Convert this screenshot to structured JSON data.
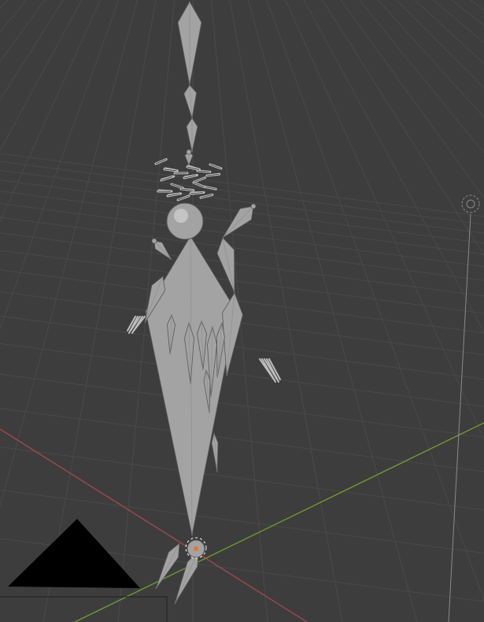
{
  "viewport": {
    "mode": "3d-viewport",
    "background_color": "#3d3d3d",
    "grid_color": "#4a4a4a",
    "x_axis_color": "#a0484e",
    "y_axis_color": "#6f9a2e",
    "bone_fill": "#a3a3a3",
    "bone_stroke": "#585858",
    "camera_color": "#000000",
    "origin_marker_color": "#e8742a",
    "light_gizmo_color": "#8a8a8a",
    "objects": [
      {
        "name": "armature",
        "type": "armature-bones"
      },
      {
        "name": "camera",
        "type": "camera-gizmo"
      },
      {
        "name": "light",
        "type": "light-gizmo"
      },
      {
        "name": "3d-cursor",
        "type": "cursor"
      }
    ]
  }
}
